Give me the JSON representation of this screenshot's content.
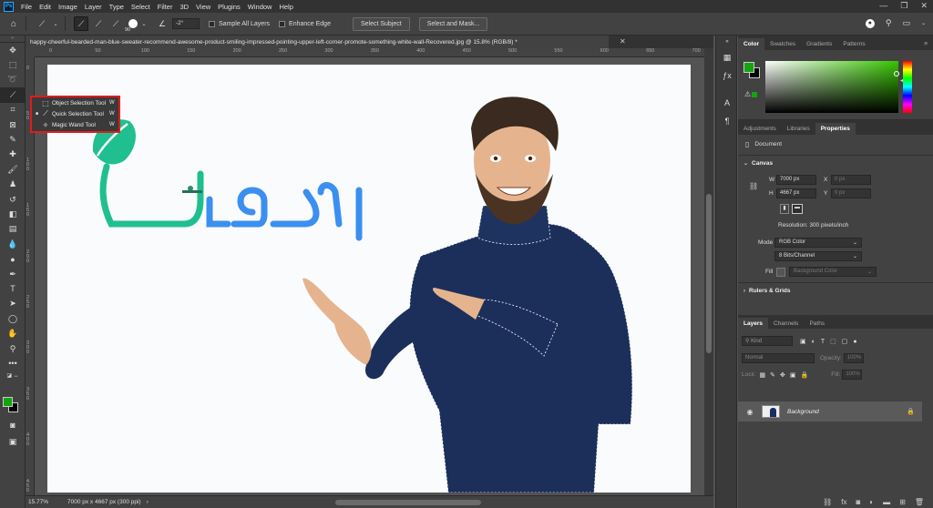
{
  "app": {
    "logo": "Ps",
    "menu": [
      "File",
      "Edit",
      "Image",
      "Layer",
      "Type",
      "Select",
      "Filter",
      "3D",
      "View",
      "Plugins",
      "Window",
      "Help"
    ],
    "window_controls": [
      "—",
      "❐",
      "✕"
    ]
  },
  "options_bar": {
    "brush_size": "90",
    "angle_value": "-2°",
    "sample_all_layers": "Sample All Layers",
    "enhance_edge": "Enhance Edge",
    "select_subject": "Select Subject",
    "select_and_mask": "Select and Mask..."
  },
  "document": {
    "tab_title": "happy-cheerful-bearded-man-blue-sweater-recommend-awesome-product-smiling-impressed-pointing-upper-left-corner-promote-something-white-wall-Recovered.jpg @ 15.8% (RGB/8) *",
    "close": "✕",
    "ruler_h": [
      "0",
      "50",
      "100",
      "150",
      "200",
      "250",
      "300",
      "350",
      "400",
      "450",
      "500",
      "550",
      "600",
      "650",
      "700"
    ],
    "ruler_v": [
      "0",
      "50",
      "100",
      "150",
      "200",
      "250",
      "300",
      "350",
      "400",
      "450"
    ],
    "logo_text": "اوکالشا"
  },
  "flyout": {
    "items": [
      {
        "label": "Object Selection Tool",
        "key": "W",
        "bullet": ""
      },
      {
        "label": "Quick Selection Tool",
        "key": "W",
        "bullet": "■"
      },
      {
        "label": "Magic Wand Tool",
        "key": "W",
        "bullet": ""
      }
    ]
  },
  "status": {
    "zoom": "15.77%",
    "info": "7000 px x 4667 px (300 ppi)"
  },
  "color_panel": {
    "tabs": [
      "Color",
      "Swatches",
      "Gradients",
      "Patterns"
    ],
    "foreground": "#15a311",
    "background": "#000000"
  },
  "properties_panel": {
    "tabs": [
      "Adjustments",
      "Libraries",
      "Properties"
    ],
    "document_label": "Document",
    "canvas_header": "Canvas",
    "w_label": "W",
    "w_value": "7000 px",
    "x_label": "X",
    "x_value": "0 px",
    "h_label": "H",
    "h_value": "4667 px",
    "y_label": "Y",
    "y_value": "0 px",
    "resolution": "Resolution: 300 pixels/inch",
    "mode_label": "Mode",
    "mode_value": "RGB Color",
    "bits_value": "8 Bits/Channel",
    "fill_label": "Fill",
    "fill_value": "Background Color",
    "rulers_grids": "Rulers & Grids"
  },
  "layers_panel": {
    "tabs": [
      "Layers",
      "Channels",
      "Paths"
    ],
    "kind_placeholder": "Kind",
    "blend_mode": "Normal",
    "opacity_label": "Opacity:",
    "opacity_value": "100%",
    "lock_label": "Lock:",
    "fill_label": "Fill:",
    "fill_value": "100%",
    "layer_name": "Background"
  },
  "colors": {
    "accent_red": "#e11b1b",
    "logo_green": "#1fbf8f",
    "logo_blue": "#3b8ff0",
    "sweater": "#1c2f5a"
  }
}
